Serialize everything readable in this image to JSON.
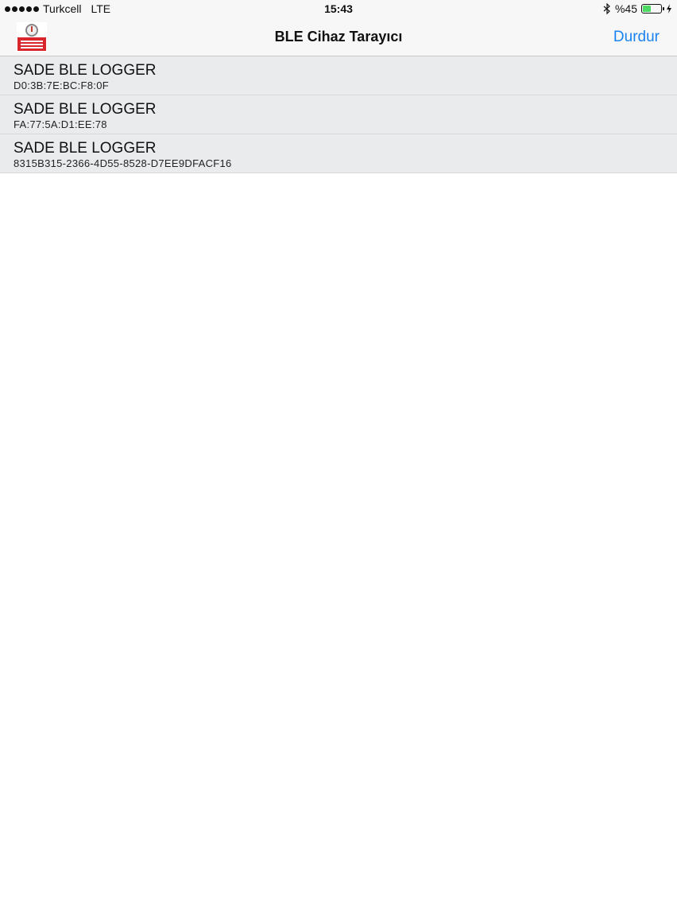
{
  "status_bar": {
    "carrier": "Turkcell",
    "network": "LTE",
    "time": "15:43",
    "battery_text": "%45",
    "battery_level": 0.45,
    "bluetooth_icon": "bluetooth-icon",
    "charging_icon": "charging-bolt-icon"
  },
  "nav": {
    "title": "BLE Cihaz Tarayıcı",
    "action_label": "Durdur",
    "logo_icon": "ble-temperature-logger-logo"
  },
  "devices": [
    {
      "name": "SADE BLE LOGGER",
      "id": "D0:3B:7E:BC:F8:0F"
    },
    {
      "name": "SADE BLE LOGGER",
      "id": "FA:77:5A:D1:EE:78"
    },
    {
      "name": "SADE BLE LOGGER",
      "id": "8315B315-2366-4D55-8528-D7EE9DFACF16"
    }
  ],
  "colors": {
    "accent": "#1a82f0",
    "row_background": "#e9ebed",
    "battery_fill": "#4cd964",
    "logo_red": "#d9262a"
  }
}
